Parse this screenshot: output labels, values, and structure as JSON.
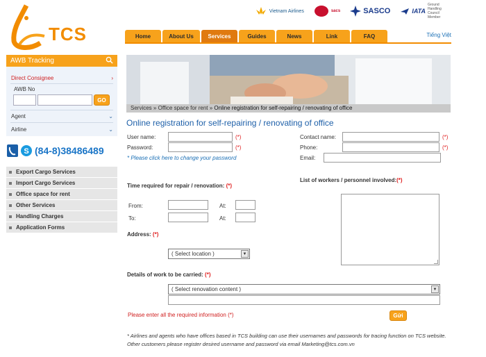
{
  "header": {
    "logo_text": "TCS",
    "partners": [
      {
        "label": "Vietnam Airlines"
      },
      {
        "label": "sacs"
      },
      {
        "label": "SASCO"
      },
      {
        "label": "IATA",
        "sub": "Ground Handling Council Member"
      }
    ],
    "language": "Tiếng Việt",
    "nav": [
      {
        "label": "Home"
      },
      {
        "label": "About Us"
      },
      {
        "label": "Services"
      },
      {
        "label": "Guides"
      },
      {
        "label": "News"
      },
      {
        "label": "Link"
      },
      {
        "label": "FAQ"
      }
    ]
  },
  "sidebar": {
    "awb_title": "AWB Tracking",
    "direct_consignee": "Direct Consignee",
    "awb_no_label": "AWB No",
    "go_label": "GO",
    "agent": "Agent",
    "airline": "Airline",
    "phone": "(84-8)38486489",
    "menu": [
      {
        "label": "Export Cargo Services"
      },
      {
        "label": "Import Cargo Services"
      },
      {
        "label": "Office space for rent"
      },
      {
        "label": "Other Services"
      },
      {
        "label": "Handling Charges"
      },
      {
        "label": "Application Forms"
      }
    ]
  },
  "breadcrumb": {
    "part1": "Services",
    "sep": "»",
    "part2": "Office space for rent",
    "part3": "Online registration for self-repairing / renovating of office"
  },
  "form": {
    "title": "Online registration for self-repairing / renovating of office",
    "username_label": "User name:",
    "password_label": "Password:",
    "required_mark": "(*)",
    "change_password_link": "* Please click here to change your password",
    "contact_label": "Contact name:",
    "phone_label": "Phone:",
    "email_label": "Email:",
    "time_label": "Time required for repair / renovation:",
    "from_label": "From:",
    "to_label": "To:",
    "at_label": "At:",
    "workers_label": "List of workers / personnel involved:",
    "address_label": "Address:",
    "location_select": "( Select location )",
    "details_label": "Details of work to be carried:",
    "renovation_select": "( Select renovation content )",
    "warning": "Please enter all the required information (*)",
    "submit": "Gửi",
    "note": "* Airlines and agents who have offices based in TCS building can use their usernames and passwords for tracing function on TCS website. Other customers please register desired username and password via email Marketing@tcs.com.vn"
  }
}
